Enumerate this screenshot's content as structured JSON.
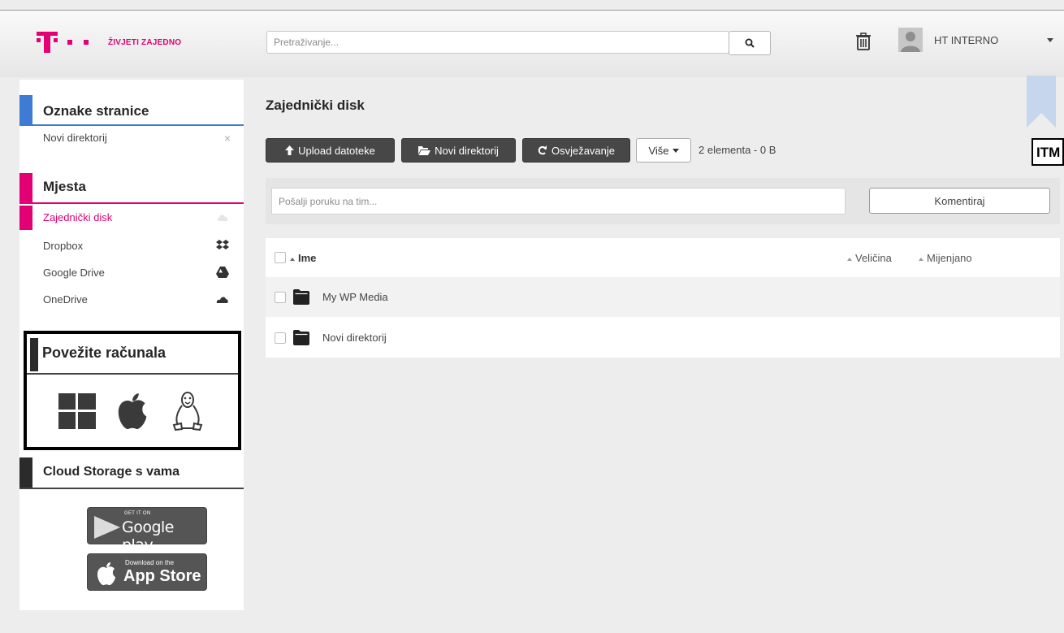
{
  "header": {
    "slogan": "ŽIVJETI ZAJEDNO",
    "search_placeholder": "Pretraživanje...",
    "user_name": "HT INTERNO"
  },
  "sidebar": {
    "bookmarks_title": "Oznake stranice",
    "bookmarks": [
      {
        "label": "Novi direktorij",
        "remove": "×"
      }
    ],
    "places_title": "Mjesta",
    "places": [
      {
        "label": "Zajednički disk",
        "icon": "cloud-icon",
        "active": true
      },
      {
        "label": "Dropbox",
        "icon": "dropbox-icon"
      },
      {
        "label": "Google Drive",
        "icon": "google-drive-icon"
      },
      {
        "label": "OneDrive",
        "icon": "onedrive-icon"
      }
    ],
    "connect_title": "Povežite računala",
    "connect_icons": [
      "windows-icon",
      "apple-icon",
      "linux-icon"
    ],
    "mobile_title": "Cloud Storage s vama",
    "google_play": {
      "small": "GET IT ON",
      "big": "Google play"
    },
    "app_store": {
      "small": "Download on the",
      "big": "App Store"
    }
  },
  "main": {
    "title": "Zajednički disk",
    "toolbar": {
      "upload": "Upload datoteke",
      "new_folder": "Novi direktorij",
      "refresh": "Osvježavanje",
      "more": "Više",
      "count": "2 elementa - 0 B",
      "itm": "ITM"
    },
    "message_placeholder": "Pošalji poruku na tim...",
    "comment_button": "Komentiraj",
    "columns": {
      "name": "Ime",
      "size": "Veličina",
      "modified": "Mijenjano"
    },
    "files": [
      {
        "name": "My WP Media",
        "type": "folder"
      },
      {
        "name": "Novi direktorij",
        "type": "folder"
      }
    ]
  },
  "colors": {
    "brand": "#e20074",
    "bookmark_accent": "#3e7bd4",
    "dark_button": "#474747"
  }
}
